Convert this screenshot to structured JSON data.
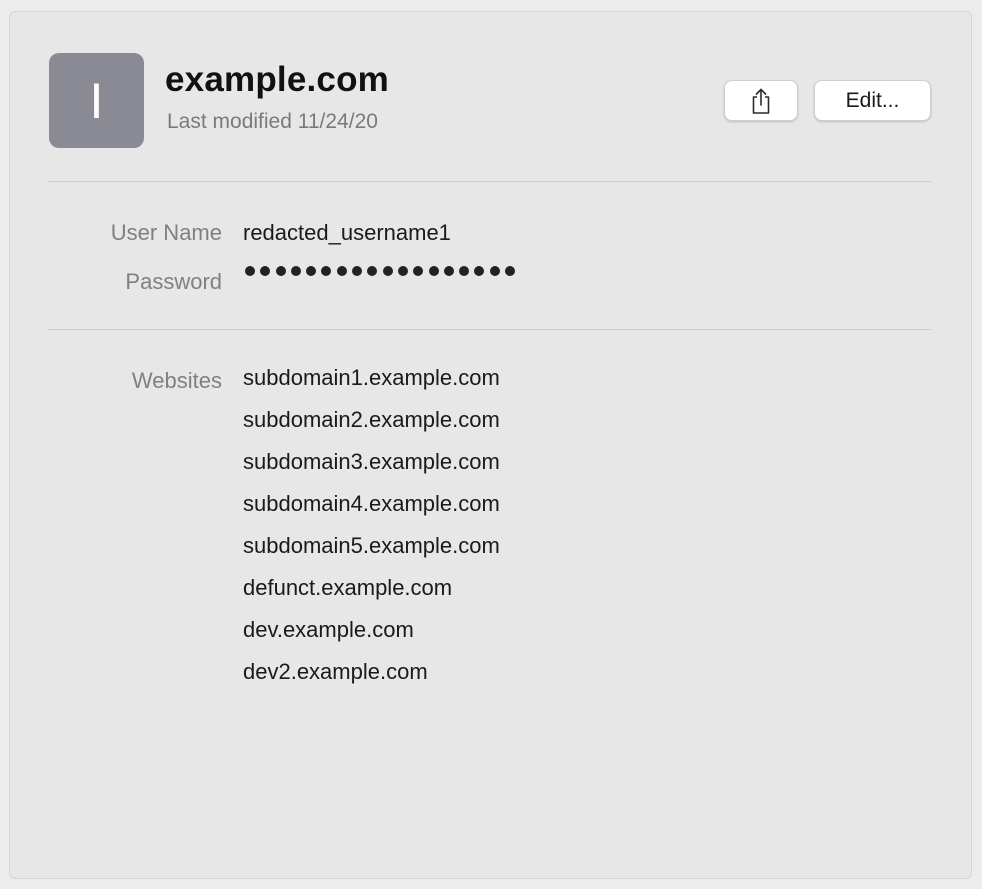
{
  "header": {
    "avatar_letter": "I",
    "title": "example.com",
    "last_modified": "Last modified 11/24/20",
    "share_icon": "share-icon",
    "edit_label": "Edit..."
  },
  "credentials": {
    "username_label": "User Name",
    "username_value": "redacted_username1",
    "password_label": "Password",
    "password_length": 18
  },
  "websites": {
    "label": "Websites",
    "items": [
      "subdomain1.example.com",
      "subdomain2.example.com",
      "subdomain3.example.com",
      "subdomain4.example.com",
      "subdomain5.example.com",
      "defunct.example.com",
      "dev.example.com",
      "dev2.example.com"
    ]
  }
}
